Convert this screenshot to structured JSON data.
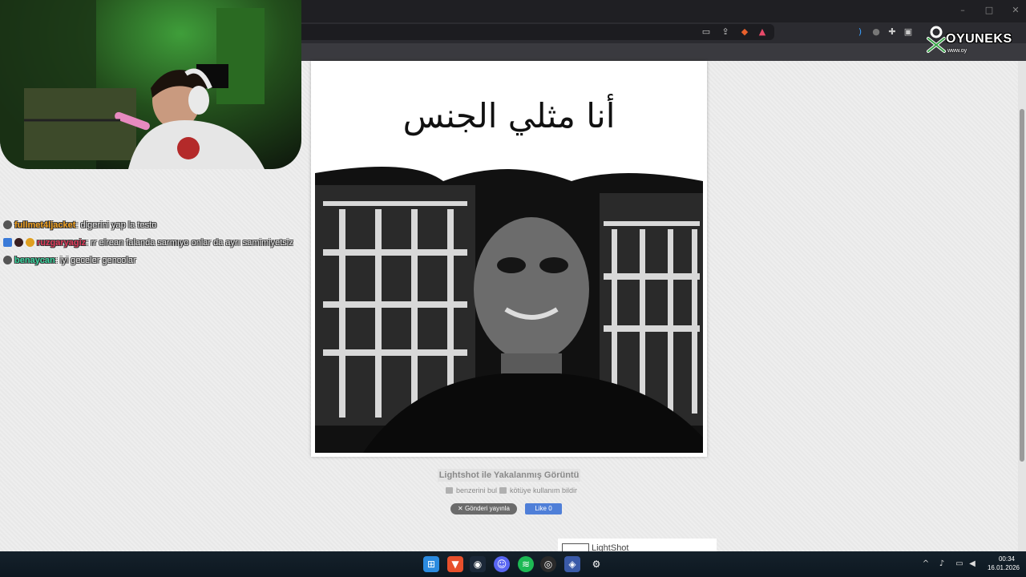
{
  "browser": {
    "window_controls": [
      "–",
      "□",
      "✕"
    ],
    "toolbar_icons": [
      "screen-icon",
      "share-icon",
      "brave-shield-icon",
      "brave-rewards-icon",
      "audio-icon",
      "circle-icon",
      "extensions-icon",
      "sidebar-icon"
    ]
  },
  "main": {
    "image_caption": "أنا مثلي الجنس",
    "lightshot_title": "Lightshot ile Yakalanmış Görüntü",
    "find_similar": "benzerini bul",
    "report_abuse": "kötüye kullanım bildir",
    "tweet_label": "Gönderi yayınla",
    "like_label": "Like 0",
    "widget_label": "LightShot"
  },
  "chat": [
    {
      "user": "fullmet4ljacket",
      "message": ": digerini yap la testo",
      "color": "#f0a020"
    },
    {
      "user": "ruzgaryagiz",
      "message": ": rr elrean falanda sarmıyo onlar da ayrı samimiyetsiz",
      "color": "#e03a5a"
    },
    {
      "user": "benaycan",
      "message": ": iyi geceler gencolar",
      "color": "#3ad6a0"
    }
  ],
  "watermark": {
    "brand": "OYUNEKS",
    "sub": "www.oy"
  },
  "taskbar": {
    "apps": [
      "windows-start-icon",
      "brave-icon",
      "steam-icon",
      "discord-icon",
      "spotify-icon",
      "obs-icon",
      "app-icon",
      "settings-icon"
    ],
    "time": "00:34",
    "date": "16.01.2026"
  },
  "colors": {
    "page_bg": "#ececec",
    "chrome_dark": "#1f1f23",
    "taskbar": "#0d1821",
    "accent_like": "#4f7fd8"
  }
}
